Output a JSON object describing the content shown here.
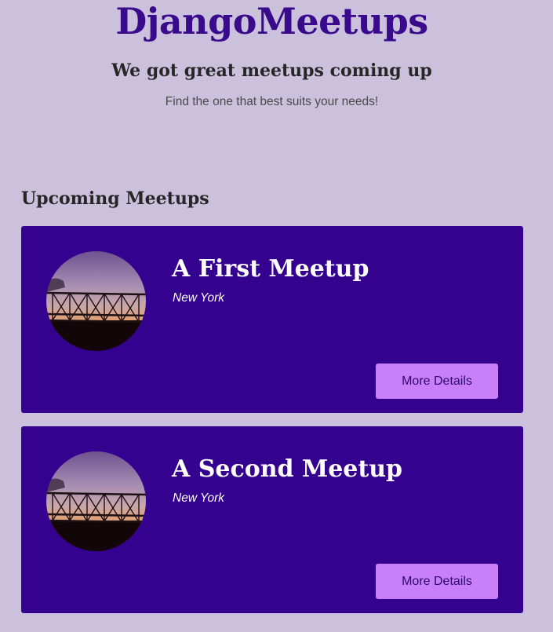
{
  "header": {
    "site_title": "DjangoMeetups",
    "tagline": "We got great meetups coming up",
    "subtitle": "Find the one that best suits your needs!"
  },
  "main": {
    "section_heading": "Upcoming Meetups",
    "meetups": [
      {
        "title": "A First Meetup",
        "location": "New York",
        "button_label": "More Details",
        "image_icon": "bridge-sunset-image"
      },
      {
        "title": "A Second Meetup",
        "location": "New York",
        "button_label": "More Details",
        "image_icon": "bridge-sunset-image"
      }
    ]
  },
  "colors": {
    "page_background": "#cbc1dc",
    "site_title": "#3a0a8c",
    "card_background": "#34028f",
    "button_background": "#c97ff8",
    "button_text": "#2b0a6e"
  }
}
